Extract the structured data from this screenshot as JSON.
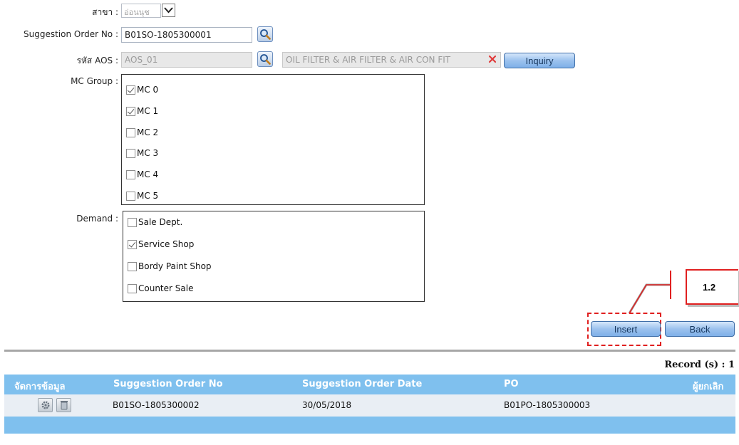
{
  "form": {
    "branch": {
      "label": "สาขา :",
      "value": "อ่อนนุช"
    },
    "suggestion_order": {
      "label": "Suggestion Order No :",
      "value": "B01SO-1805300001"
    },
    "aos": {
      "label": "รหัส AOS :",
      "value": "AOS_01",
      "description": "OIL FILTER & AIR FILTER & AIR CON FIT"
    },
    "inquiry_label": "Inquiry",
    "mc_group": {
      "label": "MC Group :",
      "items": [
        {
          "label": "MC 0",
          "checked": true
        },
        {
          "label": "MC 1",
          "checked": true
        },
        {
          "label": "MC 2",
          "checked": false
        },
        {
          "label": "MC 3",
          "checked": false
        },
        {
          "label": "MC 4",
          "checked": false
        },
        {
          "label": "MC 5",
          "checked": false
        }
      ]
    },
    "demand": {
      "label": "Demand :",
      "items": [
        {
          "label": "Sale Dept.",
          "checked": false
        },
        {
          "label": "Service Shop",
          "checked": true
        },
        {
          "label": "Bordy Paint Shop",
          "checked": false
        },
        {
          "label": "Counter Sale",
          "checked": false
        }
      ]
    }
  },
  "callout": {
    "label": "1.2",
    "accent": "#e02020"
  },
  "actions": {
    "insert_label": "Insert",
    "back_label": "Back"
  },
  "grid": {
    "record_count": "Record (s) : 1",
    "columns": [
      "จัดการข้อมูล",
      "Suggestion Order No",
      "Suggestion Order Date",
      "PO",
      "ผู้ยกเลิก"
    ],
    "rows": [
      {
        "suggestion_order_no": "B01SO-1805300002",
        "date": "30/05/2018",
        "po": "B01PO-1805300003",
        "cancelled_by": ""
      }
    ],
    "header_color": "#7fc0ee"
  }
}
